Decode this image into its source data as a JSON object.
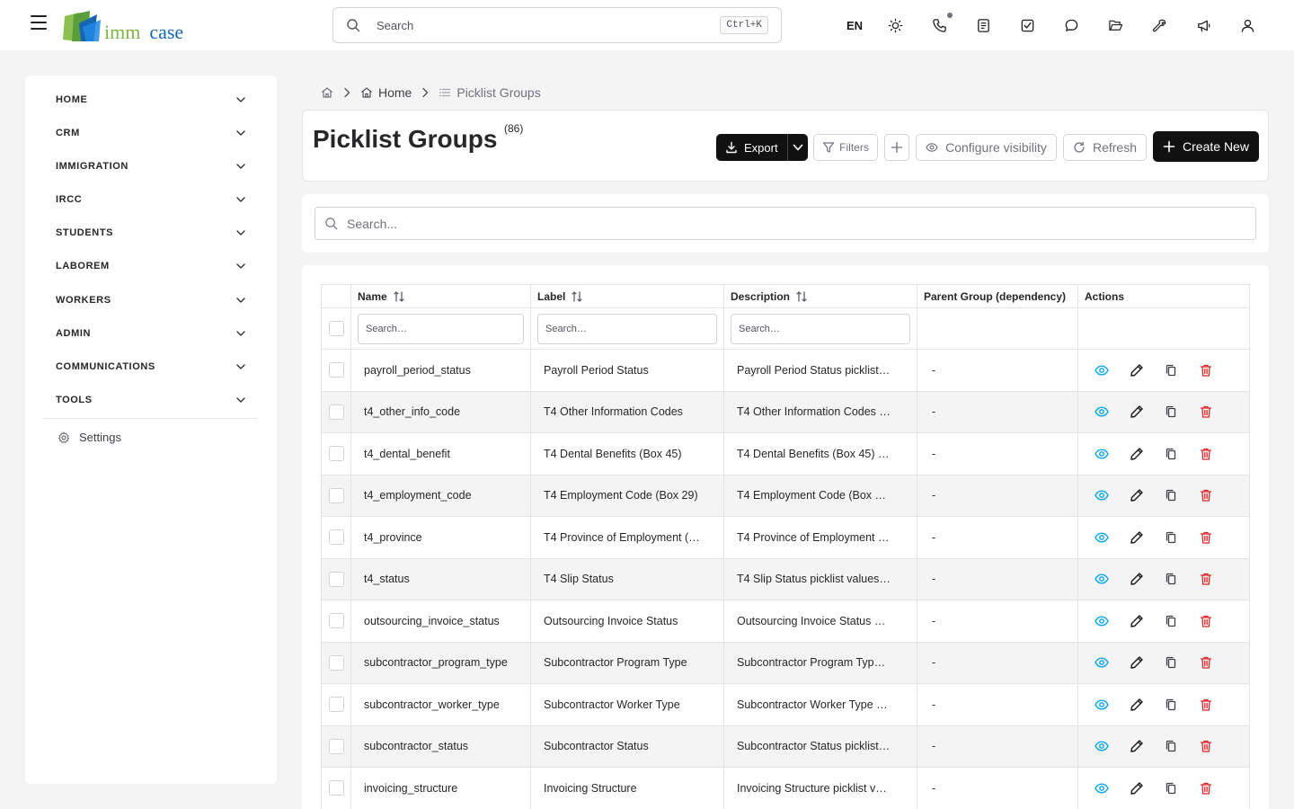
{
  "app": {
    "logo_text_a": "imm",
    "logo_text_b": "case"
  },
  "topbar": {
    "search_placeholder": "Search",
    "search_shortcut": "Ctrl+K",
    "language": "EN",
    "icons": [
      "sun-icon",
      "phone-icon",
      "notes-icon",
      "tasks-icon",
      "chat-icon",
      "folder-icon",
      "tools-icon",
      "megaphone-icon",
      "user-icon"
    ]
  },
  "sidebar": {
    "items": [
      {
        "label": "HOME"
      },
      {
        "label": "CRM"
      },
      {
        "label": "IMMIGRATION"
      },
      {
        "label": "IRCC"
      },
      {
        "label": "STUDENTS"
      },
      {
        "label": "LABOREM"
      },
      {
        "label": "WORKERS"
      },
      {
        "label": "ADMIN"
      },
      {
        "label": "COMMUNICATIONS"
      },
      {
        "label": "TOOLS"
      }
    ],
    "settings_label": "Settings"
  },
  "breadcrumb": {
    "home": "Home",
    "current": "Picklist Groups"
  },
  "header": {
    "title": "Picklist Groups",
    "count": "(86)",
    "export_label": "Export",
    "filters_label": "Filters",
    "visibility_label": "Configure visibility",
    "refresh_label": "Refresh",
    "create_label": "Create New"
  },
  "search": {
    "placeholder": "Search..."
  },
  "table": {
    "columns": [
      "Name",
      "Label",
      "Description",
      "Parent Group (dependency)",
      "Actions"
    ],
    "filter_placeholder": "Search…",
    "rows": [
      {
        "name": "payroll_period_status",
        "label": "Payroll Period Status",
        "description": "Payroll Period Status picklist …",
        "parent": "-"
      },
      {
        "name": "t4_other_info_code",
        "label": "T4 Other Information Codes",
        "description": "T4 Other Information Codes …",
        "parent": "-"
      },
      {
        "name": "t4_dental_benefit",
        "label": "T4 Dental Benefits (Box 45)",
        "description": "T4 Dental Benefits (Box 45) …",
        "parent": "-"
      },
      {
        "name": "t4_employment_code",
        "label": "T4 Employment Code (Box 29)",
        "description": "T4 Employment Code (Box 2…",
        "parent": "-"
      },
      {
        "name": "t4_province",
        "label": "T4 Province of Employment (…",
        "description": "T4 Province of Employment (…",
        "parent": "-"
      },
      {
        "name": "t4_status",
        "label": "T4 Slip Status",
        "description": "T4 Slip Status picklist values…",
        "parent": "-"
      },
      {
        "name": "outsourcing_invoice_status",
        "label": "Outsourcing Invoice Status",
        "description": "Outsourcing Invoice Status p…",
        "parent": "-"
      },
      {
        "name": "subcontractor_program_type",
        "label": "Subcontractor Program Type",
        "description": "Subcontractor Program Type…",
        "parent": "-"
      },
      {
        "name": "subcontractor_worker_type",
        "label": "Subcontractor Worker Type",
        "description": "Subcontractor Worker Type …",
        "parent": "-"
      },
      {
        "name": "subcontractor_status",
        "label": "Subcontractor Status",
        "description": "Subcontractor Status picklist …",
        "parent": "-"
      },
      {
        "name": "invoicing_structure",
        "label": "Invoicing Structure",
        "description": "Invoicing Structure picklist va…",
        "parent": "-"
      }
    ]
  },
  "colors": {
    "view": "#0ea5e9",
    "edit": "#18181b",
    "copy": "#3f3f46",
    "delete": "#dc2626",
    "logo_green": "#7ab648",
    "logo_blue": "#1565b0"
  }
}
